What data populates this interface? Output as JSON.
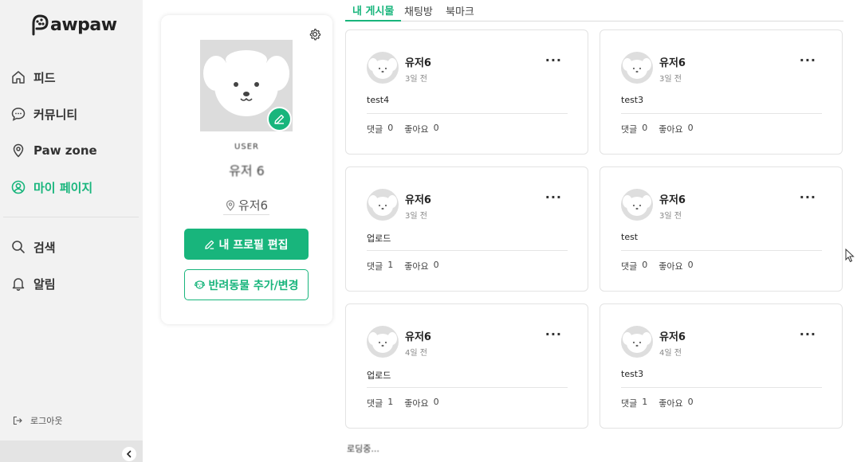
{
  "app": {
    "logo_text": "awpaw"
  },
  "sidebar": {
    "items": [
      {
        "label": "피드",
        "icon": "home-icon"
      },
      {
        "label": "커뮤니티",
        "icon": "chat-bubble-icon"
      },
      {
        "label": "Paw zone",
        "icon": "location-pin-icon"
      },
      {
        "label": "마이 페이지",
        "icon": "user-circle-icon",
        "active": true
      },
      {
        "label": "검색",
        "icon": "search-icon"
      },
      {
        "label": "알림",
        "icon": "bell-icon"
      }
    ],
    "logout_label": "로그아웃",
    "accent_color": "#18b57c"
  },
  "profile": {
    "label": "USER",
    "name_blurred": "유저 6",
    "location": "유저6",
    "edit_button": "내 프로필 편집",
    "pet_button": "반려동물 추가/변경"
  },
  "tabs": [
    {
      "label": "내 게시물",
      "active": true
    },
    {
      "label": "채팅방"
    },
    {
      "label": "북마크"
    }
  ],
  "posts": [
    {
      "author": "유저6",
      "time": "3일 전",
      "content": "test4",
      "comments_label": "댓글",
      "comments": "0",
      "likes_label": "좋아요",
      "likes": "0"
    },
    {
      "author": "유저6",
      "time": "3일 전",
      "content": "test3",
      "comments_label": "댓글",
      "comments": "0",
      "likes_label": "좋아요",
      "likes": "0"
    },
    {
      "author": "유저6",
      "time": "3일 전",
      "content": "업로드",
      "comments_label": "댓글",
      "comments": "1",
      "likes_label": "좋아요",
      "likes": "0"
    },
    {
      "author": "유저6",
      "time": "3일 전",
      "content": "test",
      "comments_label": "댓글",
      "comments": "0",
      "likes_label": "좋아요",
      "likes": "0"
    },
    {
      "author": "유저6",
      "time": "4일 전",
      "content": "업로드",
      "comments_label": "댓글",
      "comments": "1",
      "likes_label": "좋아요",
      "likes": "0"
    },
    {
      "author": "유저6",
      "time": "4일 전",
      "content": "test3",
      "comments_label": "댓글",
      "comments": "1",
      "likes_label": "좋아요",
      "likes": "0"
    }
  ],
  "more_label": "···",
  "loading_text": "로딩중..."
}
